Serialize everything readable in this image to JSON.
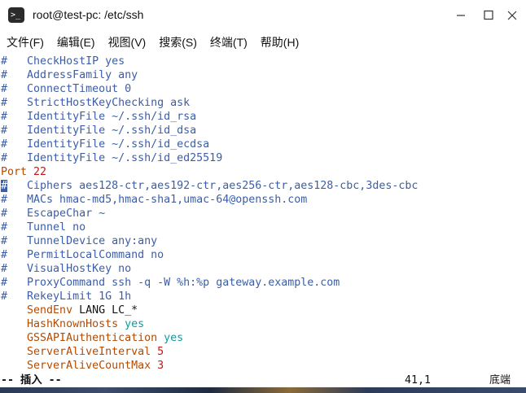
{
  "window": {
    "title": "root@test-pc: /etc/ssh",
    "icon": "terminal-icon",
    "controls": [
      "minimize-icon",
      "maximize-icon",
      "close-icon"
    ]
  },
  "menu": [
    {
      "label": "文件(F)"
    },
    {
      "label": "编辑(E)"
    },
    {
      "label": "视图(V)"
    },
    {
      "label": "搜索(S)"
    },
    {
      "label": "终端(T)"
    },
    {
      "label": "帮助(H)"
    }
  ],
  "lines": [
    {
      "prefix": "#",
      "text": "   CheckHostIP yes"
    },
    {
      "prefix": "#",
      "text": "   AddressFamily any"
    },
    {
      "prefix": "#",
      "text": "   ConnectTimeout 0"
    },
    {
      "prefix": "#",
      "text": "   StrictHostKeyChecking ask"
    },
    {
      "prefix": "#",
      "text": "   IdentityFile ~/.ssh/id_rsa"
    },
    {
      "prefix": "#",
      "text": "   IdentityFile ~/.ssh/id_dsa"
    },
    {
      "prefix": "#",
      "text": "   IdentityFile ~/.ssh/id_ecdsa"
    },
    {
      "prefix": "#",
      "text": "   IdentityFile ~/.ssh/id_ed25519"
    },
    {
      "key": "Port",
      "value": "22"
    },
    {
      "prefix": "#",
      "text": "   Ciphers aes128-ctr,aes192-ctr,aes256-ctr,aes128-cbc,3des-cbc",
      "cursor": true
    },
    {
      "prefix": "#",
      "text": "   MACs hmac-md5,hmac-sha1,umac-64@openssh.com"
    },
    {
      "prefix": "#",
      "text": "   EscapeChar ~"
    },
    {
      "prefix": "#",
      "text": "   Tunnel no"
    },
    {
      "prefix": "#",
      "text": "   TunnelDevice any:any"
    },
    {
      "prefix": "#",
      "text": "   PermitLocalCommand no"
    },
    {
      "prefix": "#",
      "text": "   VisualHostKey no"
    },
    {
      "prefix": "#",
      "text": "   ProxyCommand ssh -q -W %h:%p gateway.example.com"
    },
    {
      "prefix": "#",
      "text": "   RekeyLimit 1G 1h"
    },
    {
      "indent": "    ",
      "key": "SendEnv",
      "plain": " LANG LC_*"
    },
    {
      "indent": "    ",
      "key": "HashKnownHosts",
      "bool": "yes"
    },
    {
      "indent": "    ",
      "key": "GSSAPIAuthentication",
      "bool": "yes"
    },
    {
      "indent": "    ",
      "key": "ServerAliveInterval",
      "value": "5"
    },
    {
      "indent": "    ",
      "key": "ServerAliveCountMax",
      "value": "3"
    }
  ],
  "status": {
    "mode": "-- 插入 --",
    "position": "41,1",
    "scroll": "底端"
  },
  "colors": {
    "comment": "#3a5ea8",
    "keyword": "#b34b00",
    "number": "#c01818",
    "boolean": "#0f9aa0"
  }
}
